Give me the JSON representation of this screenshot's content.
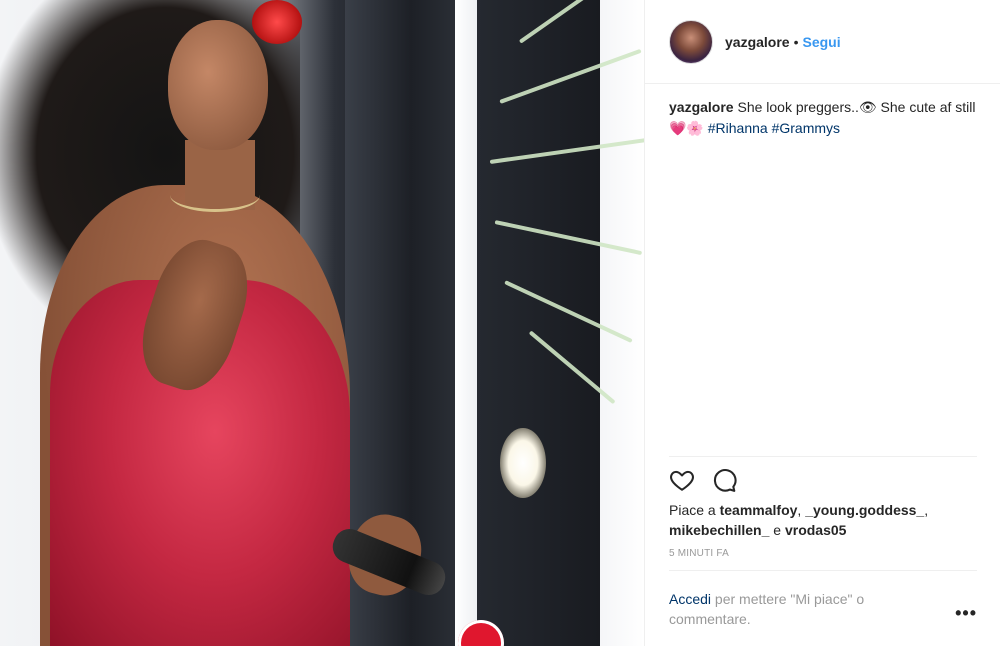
{
  "post": {
    "author": {
      "username": "yazgalore",
      "separator": "•",
      "follow_label": "Segui"
    },
    "caption": {
      "username": "yazgalore",
      "text": "She look preggers..👁 She cute af still💗🌸",
      "hashtags": [
        "#Rihanna",
        "#Grammys"
      ]
    },
    "likes": {
      "prefix": "Piace a",
      "users": [
        "teammalfoy",
        "_young.goddess_",
        "mikebechillen_"
      ],
      "joiner": "e",
      "last_user": "vrodas05",
      "separator": ","
    },
    "timestamp": "5 MINUTI FA",
    "login_prompt": {
      "link_label": "Accedi",
      "text": "per mettere \"Mi piace\" o commentare."
    },
    "more_label": "•••",
    "icons": {
      "like": "heart-icon",
      "comment": "comment-icon",
      "more": "more-options-icon"
    }
  },
  "colors": {
    "link_blue": "#3897f0",
    "hashtag_blue": "#003569",
    "meta_gray": "#999999",
    "text": "#262626"
  }
}
